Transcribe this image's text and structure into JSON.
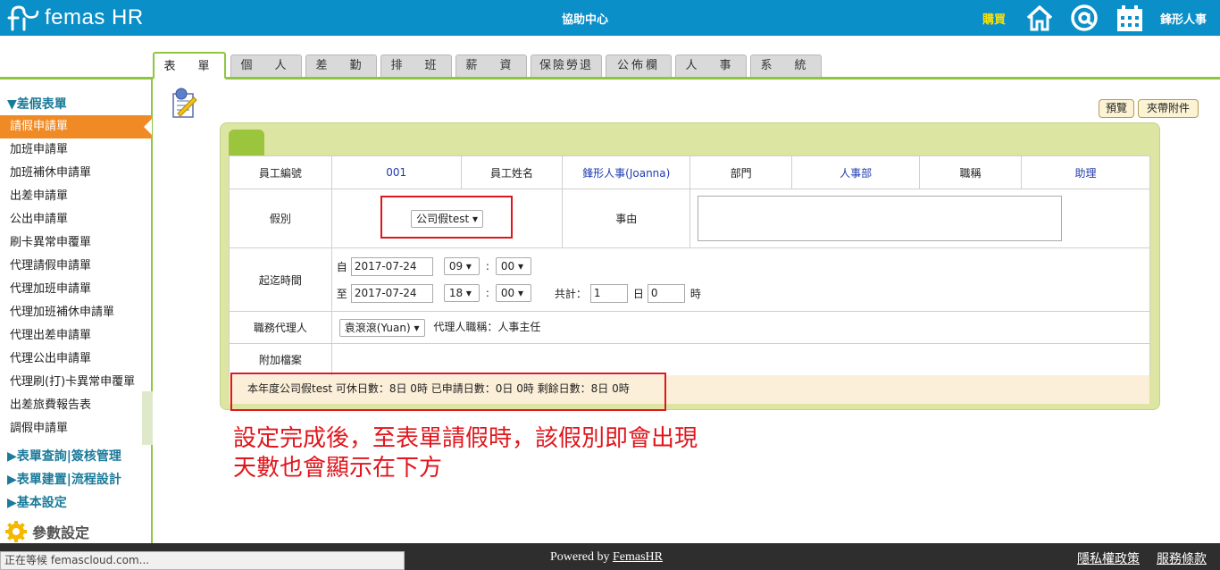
{
  "header": {
    "app_name": "femas HR",
    "center_title": "協助中心",
    "buy_label": "購買",
    "company": "鋒形人事",
    "icons": [
      "home-icon",
      "at-icon",
      "calendar-icon"
    ]
  },
  "tabs": [
    "表　單",
    "個　人",
    "差　勤",
    "排　班",
    "薪　資",
    "保險勞退",
    "公佈欄",
    "人　事",
    "系　統"
  ],
  "sidebar": {
    "section_title": "▼差假表單",
    "items": [
      "請假申請單",
      "加班申請單",
      "加班補休申請單",
      "出差申請單",
      "公出申請單",
      "刷卡異常申覆單",
      "代理請假申請單",
      "代理加班申請單",
      "代理加班補休申請單",
      "代理出差申請單",
      "代理公出申請單",
      "代理刷(打)卡異常申覆單",
      "出差旅費報告表",
      "調假申請單"
    ],
    "sections": [
      "▶表單查詢|簽核管理",
      "▶表單建置|流程設計",
      "▶基本設定"
    ],
    "param_label": "參數設定"
  },
  "actions": {
    "preview": "預覽",
    "attach": "夾帶附件"
  },
  "form": {
    "emp_no_label": "員工編號",
    "emp_no": "001",
    "emp_name_label": "員工姓名",
    "emp_name": "鋒形人事(Joanna)",
    "dept_label": "部門",
    "dept": "人事部",
    "title_label": "職稱",
    "title": "助理",
    "leave_type_label": "假別",
    "leave_type": "公司假test",
    "reason_label": "事由",
    "period_label": "起迄時間",
    "from_label": "自",
    "from_date": "2017-07-24",
    "from_hour": "09",
    "from_min": "00",
    "to_label": "至",
    "to_date": "2017-07-24",
    "to_hour": "18",
    "to_min": "00",
    "colon": ":",
    "total_label": "共計：",
    "total_days": "1",
    "day_unit": "日",
    "total_hours": "0",
    "hour_unit": "時",
    "agent_label": "職務代理人",
    "agent": "袁滾滾(Yuan)",
    "agent_title": "代理人職稱：人事主任",
    "attach_label": "附加檔案",
    "quota_text": "本年度公司假test  可休日數：8日 0時   已申請日數：0日 0時   剩餘日數：8日 0時"
  },
  "annotation": {
    "line1": "設定完成後，至表單請假時，該假別即會出現",
    "line2": "天數也會顯示在下方"
  },
  "footer": {
    "status": "正在等候 femascloud.com...",
    "powered_prefix": "Powered by ",
    "powered_link": "FemasHR",
    "privacy": "隱私權政策",
    "terms": "服務條款"
  },
  "colors": {
    "header_bg": "#0b8fc8",
    "accent_green": "#8dc63f",
    "active_orange": "#f08a24",
    "annotation_red": "#e0161c"
  }
}
